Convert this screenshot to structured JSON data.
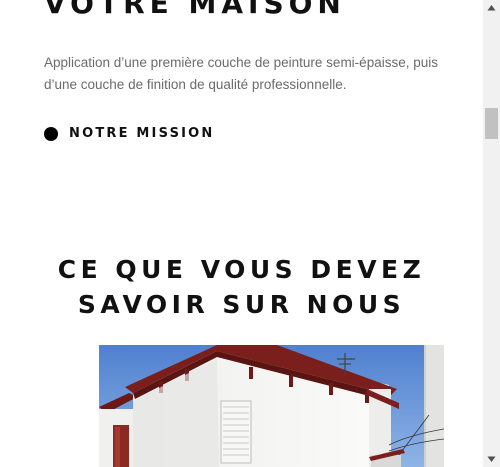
{
  "hero": {
    "title": "VOTRE MAISON",
    "description": "Application d’une première couche de peinture semi-épaisse, puis d’une couche de finition de qualité professionnelle.",
    "mission_link": "NOTRE MISSION"
  },
  "about": {
    "heading_line1": "CE QUE VOUS DEVEZ",
    "heading_line2": "SAVOIR SUR NOUS"
  },
  "icons": {
    "mission_bullet": "filled-circle",
    "scroll_up": "triangle-up",
    "scroll_down": "triangle-down"
  },
  "colors": {
    "text": "#111111",
    "description": "#6b6b6b",
    "sky": "#5f8ed6",
    "roof_trim": "#7a1f1c",
    "wall": "#f4f4f2"
  }
}
